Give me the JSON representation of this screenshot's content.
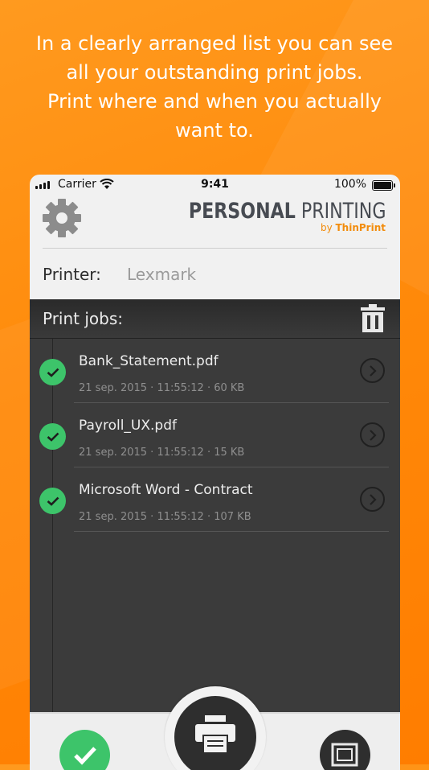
{
  "caption": {
    "line1": "In a clearly arranged list you can see",
    "line2": "all your outstanding print jobs.",
    "line3": "Print where and when you actually",
    "line4": "want to."
  },
  "status_bar": {
    "carrier": "Carrier",
    "time": "9:41",
    "battery": "100%"
  },
  "header": {
    "logo_bold": "PERSONAL",
    "logo_light": " PRINTING",
    "logo_by": "by ",
    "logo_brand": "ThinPrint"
  },
  "printer": {
    "label": "Printer:",
    "value": "Lexmark"
  },
  "jobs": {
    "title": "Print jobs:",
    "items": [
      {
        "name": "Bank_Statement.pdf",
        "meta": "21 sep. 2015 · 11:55:12 · 60 KB"
      },
      {
        "name": "Payroll_UX.pdf",
        "meta": "21 sep. 2015 · 11:55:12 · 15 KB"
      },
      {
        "name": "Microsoft Word - Contract",
        "meta": "21 sep. 2015 · 11:55:12 · 107 KB"
      }
    ]
  },
  "colors": {
    "background": "#ff8a0a",
    "status_ok": "#3dc46a",
    "brand_orange": "#f28c0c",
    "dark_panel": "#3b3b3b"
  },
  "icons": [
    "gear-icon",
    "trash-icon",
    "check-icon",
    "chevron-right-icon",
    "printer-icon",
    "preview-icon",
    "wifi-icon"
  ]
}
